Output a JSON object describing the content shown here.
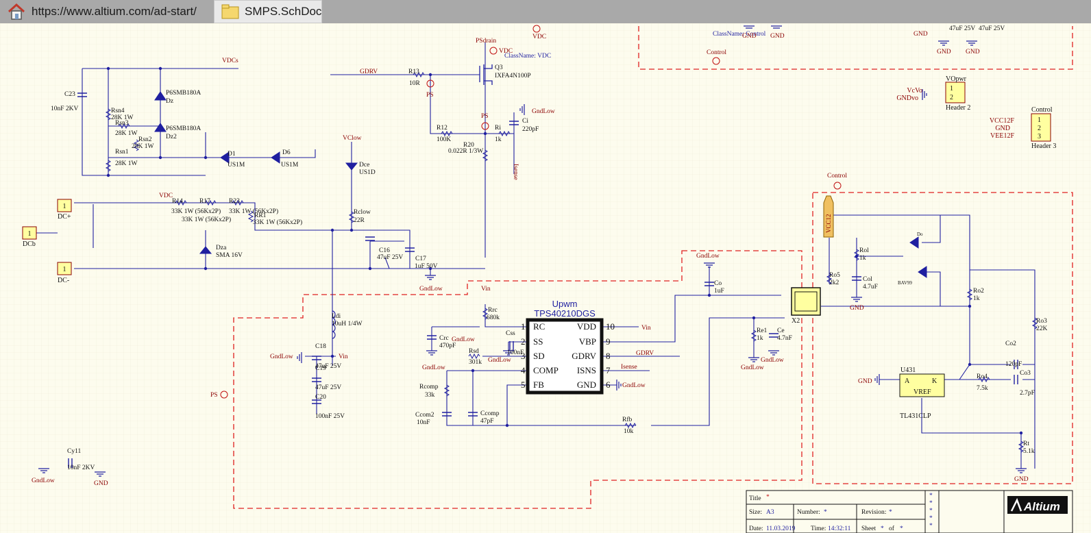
{
  "tabs": [
    {
      "label": "https://www.altium.com/ad-start/",
      "icon": "home-icon"
    },
    {
      "label": "SMPS.SchDoc",
      "icon": "folder-icon"
    }
  ],
  "colors": {
    "background": "#fdfcee",
    "grid": "#ece9d6",
    "wire": "#1f1fa0",
    "net_label": "#8b0000",
    "harness": "#e02020",
    "chip_fill": "#ffffff",
    "header_fill": "#ffffa0"
  },
  "schematic": {
    "ic_main": {
      "title": "Upwm",
      "part": "TPS40210DGS",
      "pins_left": [
        {
          "num": "1",
          "name": "RC"
        },
        {
          "num": "2",
          "name": "SS"
        },
        {
          "num": "3",
          "name": "SD"
        },
        {
          "num": "4",
          "name": "COMP"
        },
        {
          "num": "5",
          "name": "FB"
        }
      ],
      "pins_right": [
        {
          "num": "10",
          "name": "VDD"
        },
        {
          "num": "9",
          "name": "VBP"
        },
        {
          "num": "8",
          "name": "GDRV"
        },
        {
          "num": "7",
          "name": "ISNS"
        },
        {
          "num": "6",
          "name": "GND"
        }
      ]
    },
    "net_labels": {
      "vdc_top": "VDC",
      "vdcs": "VDCs",
      "psdrain": "PSdrain",
      "vdc_q3": "VDC",
      "classname_vdc": "ClassName: VDC",
      "gdrv_left": "GDRV",
      "ps_r13": "PS",
      "ps_mid": "PS",
      "vclow": "VClow",
      "isense": "Isense",
      "vdc_r14": "VDC",
      "vin_rrc": "Vin",
      "vin_vdd": "Vin",
      "vin_c18": "Vin",
      "gdrv_right": "GDRV",
      "isense_right": "Isense",
      "control_top": "Control",
      "control_right": "Control",
      "classname_control": "ClassName: Control",
      "ps_left": "PS"
    },
    "ground_labels": {
      "gndlow_ci": "GndLow",
      "gndlow_c16": "GndLow",
      "gndlow_co": "GndLow",
      "gndlow_c18": "GndLow",
      "gndlow_crc": "GndLow",
      "gndlow_crc2": "GndLow",
      "gndlow_css": "GndLow",
      "gndlow_pin6": "GndLow",
      "gndlow_re1": "GndLow",
      "gndlow_re2": "GndLow",
      "gndlow_cy11": "GndLow",
      "gnd_cy11": "GND",
      "gnd_col": "GND",
      "gnd_u431": "GND",
      "gnd_rt": "GND",
      "gnd_top1": "GND",
      "gnd_top2": "GND",
      "gnd_top3": "GND",
      "gnd_top4": "GND",
      "gnd_top5": "GND"
    },
    "components": {
      "c23": {
        "ref": "C23",
        "value": "10nF 2KV"
      },
      "rsn4": {
        "ref": "Rsn4",
        "value": "28K 1W"
      },
      "rsn3": {
        "ref": "Rsn3",
        "value": "28K 1W"
      },
      "rsn2": {
        "ref": "Rsn2",
        "value": "28K 1W"
      },
      "rsn1": {
        "ref": "Rsn1",
        "value": "28K 1W"
      },
      "dz": {
        "ref": "Dz",
        "value": "P6SMB180A"
      },
      "dz2": {
        "ref": "Dz2",
        "value": "P6SMB180A"
      },
      "d1": {
        "ref": "D1",
        "value": "US1M"
      },
      "d6": {
        "ref": "D6",
        "value": "US1M"
      },
      "r13": {
        "ref": "R13",
        "value": "10R"
      },
      "q3": {
        "ref": "Q3",
        "value": "IXFA4N100P"
      },
      "r12": {
        "ref": "R12",
        "value": "100K"
      },
      "r20": {
        "ref": "R20",
        "value": "0.022R 1/3W"
      },
      "ri": {
        "ref": "Ri",
        "value": "1k"
      },
      "ci": {
        "ref": "Ci",
        "value": "220pF"
      },
      "dce": {
        "ref": "Dce",
        "value": "US1D"
      },
      "rclow": {
        "ref": "Rclow",
        "value": "22R"
      },
      "r14": {
        "ref": "R14",
        "value": "33K 1W (56Kx2P)"
      },
      "r17": {
        "ref": "R17",
        "value": "33K 1W (56Kx2P)"
      },
      "r23": {
        "ref": "R23",
        "value": "33K 1W (56Kx2P)"
      },
      "rr1": {
        "ref": "RR1",
        "value": "33K 1W (56Kx2P)"
      },
      "dza": {
        "ref": "Dza",
        "value": "SMA 16V"
      },
      "c16": {
        "ref": "C16",
        "value": "47uF 25V"
      },
      "c17": {
        "ref": "C17",
        "value": "1uF 50V"
      },
      "ldi": {
        "ref": "Ldi",
        "value": "10uH 1/4W"
      },
      "c18": {
        "ref": "C18",
        "value": "47uF 25V"
      },
      "c19": {
        "ref": "C19",
        "value": "47uF 25V"
      },
      "c20": {
        "ref": "C20",
        "value": "100nF 25V"
      },
      "rrc": {
        "ref": "Rrc",
        "value": "680k"
      },
      "crc": {
        "ref": "Crc",
        "value": "470pF"
      },
      "css": {
        "ref": "Css",
        "value": "100nF"
      },
      "rsd": {
        "ref": "Rsd",
        "value": "301k"
      },
      "rcomp": {
        "ref": "Rcomp",
        "value": "33k"
      },
      "ccom2": {
        "ref": "Ccom2",
        "value": "10nF"
      },
      "ccomp": {
        "ref": "Ccomp",
        "value": "47pF"
      },
      "rfb": {
        "ref": "Rfb",
        "value": "10k"
      },
      "co": {
        "ref": "Co",
        "value": "1uF"
      },
      "re1": {
        "ref": "Re1",
        "value": "1k"
      },
      "ce": {
        "ref": "Ce",
        "value": "4.7nF"
      },
      "x2": {
        "ref": "X2",
        "value": ""
      },
      "rol": {
        "ref": "Rol",
        "value": "1k"
      },
      "col": {
        "ref": "Col",
        "value": "4.7uF"
      },
      "ro5": {
        "ref": "Ro5",
        "value": "2k2"
      },
      "ro2": {
        "ref": "Ro2",
        "value": "1k"
      },
      "ro3": {
        "ref": "Ro3",
        "value": "22K"
      },
      "co2": {
        "ref": "Co2",
        "value": "120pF"
      },
      "co3": {
        "ref": "Co3",
        "value": "2.7pF"
      },
      "ro4": {
        "ref": "Ro4",
        "value": "7.5k"
      },
      "rt": {
        "ref": "Rt",
        "value": "5.1k"
      },
      "u431": {
        "ref": "U431",
        "value": "TL431CLP",
        "pin_a": "A",
        "pin_k": "K",
        "center": "VREF"
      },
      "do": {
        "ref": "Do",
        "value": "BAV99"
      },
      "cy11": {
        "ref": "Cy11",
        "value": "10nF 2KV"
      },
      "cap_top": {
        "ref": "",
        "value": "47uF 25V"
      },
      "cap_top2": {
        "ref": "",
        "value": "47uF 25V"
      }
    },
    "connectors": {
      "dc_plus": {
        "ref": "DC+",
        "pin": "1"
      },
      "dc_minus": {
        "ref": "DC-",
        "pin": "1"
      },
      "dcb": {
        "ref": "DCb",
        "pin": "1"
      },
      "vopwr": {
        "ref": "VOpwr",
        "title": "Header 2",
        "pins": [
          "1",
          "2"
        ],
        "nets": [
          "VcVo",
          "GNDvo"
        ]
      },
      "control": {
        "ref": "Control",
        "title": "Header 3",
        "pins": [
          "1",
          "2",
          "3"
        ],
        "nets": [
          "VCC12F",
          "GND",
          "VEE12F"
        ]
      },
      "vcc12": {
        "label": "VCC12"
      }
    },
    "title_block": {
      "title_label": "Title",
      "title_value": "*",
      "size_label": "Size:",
      "size_value": "A3",
      "number_label": "Number:",
      "number_value": "*",
      "revision_label": "Revision:",
      "revision_value": "*",
      "date_label": "Date:",
      "date_value": "11.03.2019",
      "time_label": "Time:",
      "time_value": "14:32:11",
      "sheet_label": "Sheet",
      "sheet_value": "*",
      "of_label": "of",
      "of_value": "*",
      "stars": [
        "*",
        "*",
        "*",
        "*",
        "*"
      ],
      "logo_text": "Altium"
    }
  }
}
